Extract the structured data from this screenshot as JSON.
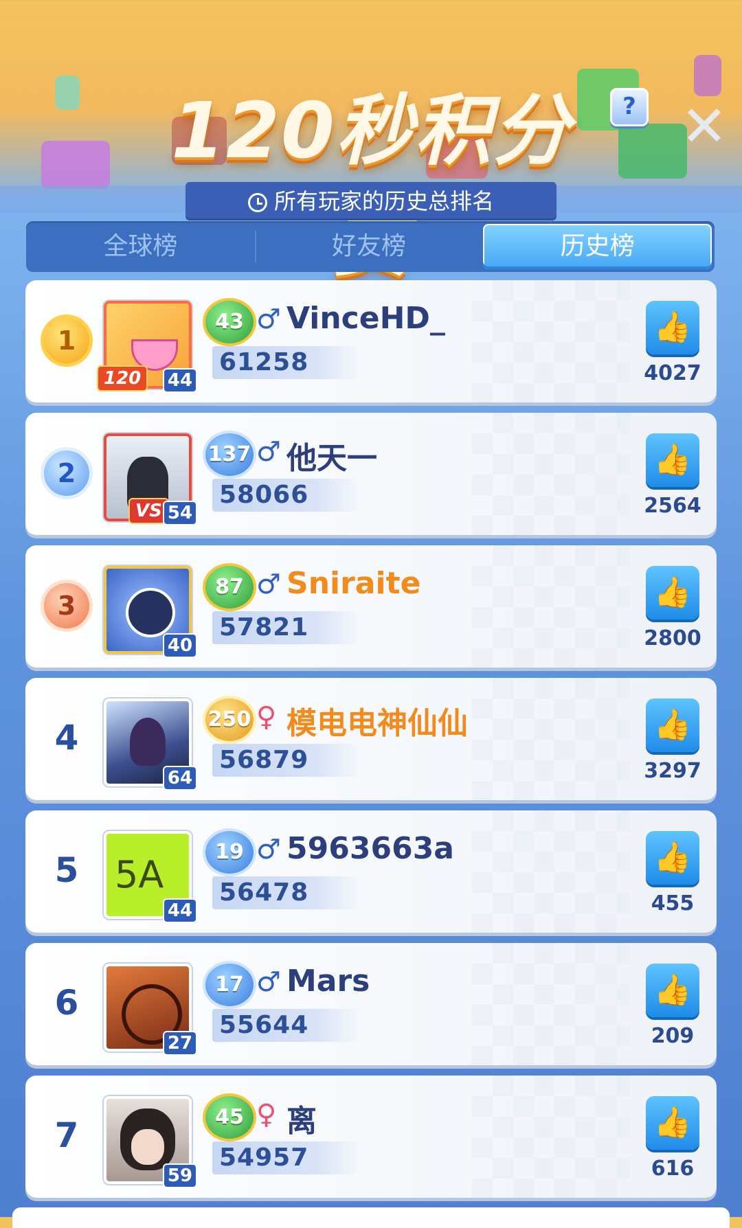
{
  "header": {
    "title": "120秒积分赛",
    "help_label": "?",
    "close_label": "✕",
    "subtitle": "所有玩家的历史总排名"
  },
  "tabs": [
    {
      "label": "全球榜",
      "active": false
    },
    {
      "label": "好友榜",
      "active": false
    },
    {
      "label": "历史榜",
      "active": true
    }
  ],
  "leaderboard": [
    {
      "rank": "1",
      "avatar_level": "44",
      "avatar_tag": "120",
      "level": "43",
      "gender": "♂",
      "name": "VinceHD_",
      "score": "61258",
      "likes": "4027"
    },
    {
      "rank": "2",
      "avatar_level": "54",
      "avatar_tag": "VS",
      "level": "137",
      "gender": "♂",
      "name": "他天一",
      "score": "58066",
      "likes": "2564"
    },
    {
      "rank": "3",
      "avatar_level": "40",
      "level": "87",
      "gender": "♂",
      "name": "Sniraite",
      "score": "57821",
      "likes": "2800"
    },
    {
      "rank": "4",
      "avatar_level": "64",
      "level": "250",
      "gender": "♀",
      "name": "模电电神仙仙",
      "score": "56879",
      "likes": "3297"
    },
    {
      "rank": "5",
      "avatar_level": "44",
      "avatar_text": "5A",
      "level": "19",
      "gender": "♂",
      "name": "5963663a",
      "score": "56478",
      "likes": "455"
    },
    {
      "rank": "6",
      "avatar_level": "27",
      "level": "17",
      "gender": "♂",
      "name": "Mars",
      "score": "55644",
      "likes": "209"
    },
    {
      "rank": "7",
      "avatar_level": "59",
      "level": "45",
      "gender": "♀",
      "name": "离",
      "score": "54957",
      "likes": "616"
    }
  ],
  "icons": {
    "like": "thumbs-up-icon",
    "clock": "clock-icon"
  },
  "colors": {
    "accent_blue": "#45a7f6",
    "name_orange": "#f28a1c",
    "male": "#2f5fc2",
    "female": "#ee4f70"
  }
}
